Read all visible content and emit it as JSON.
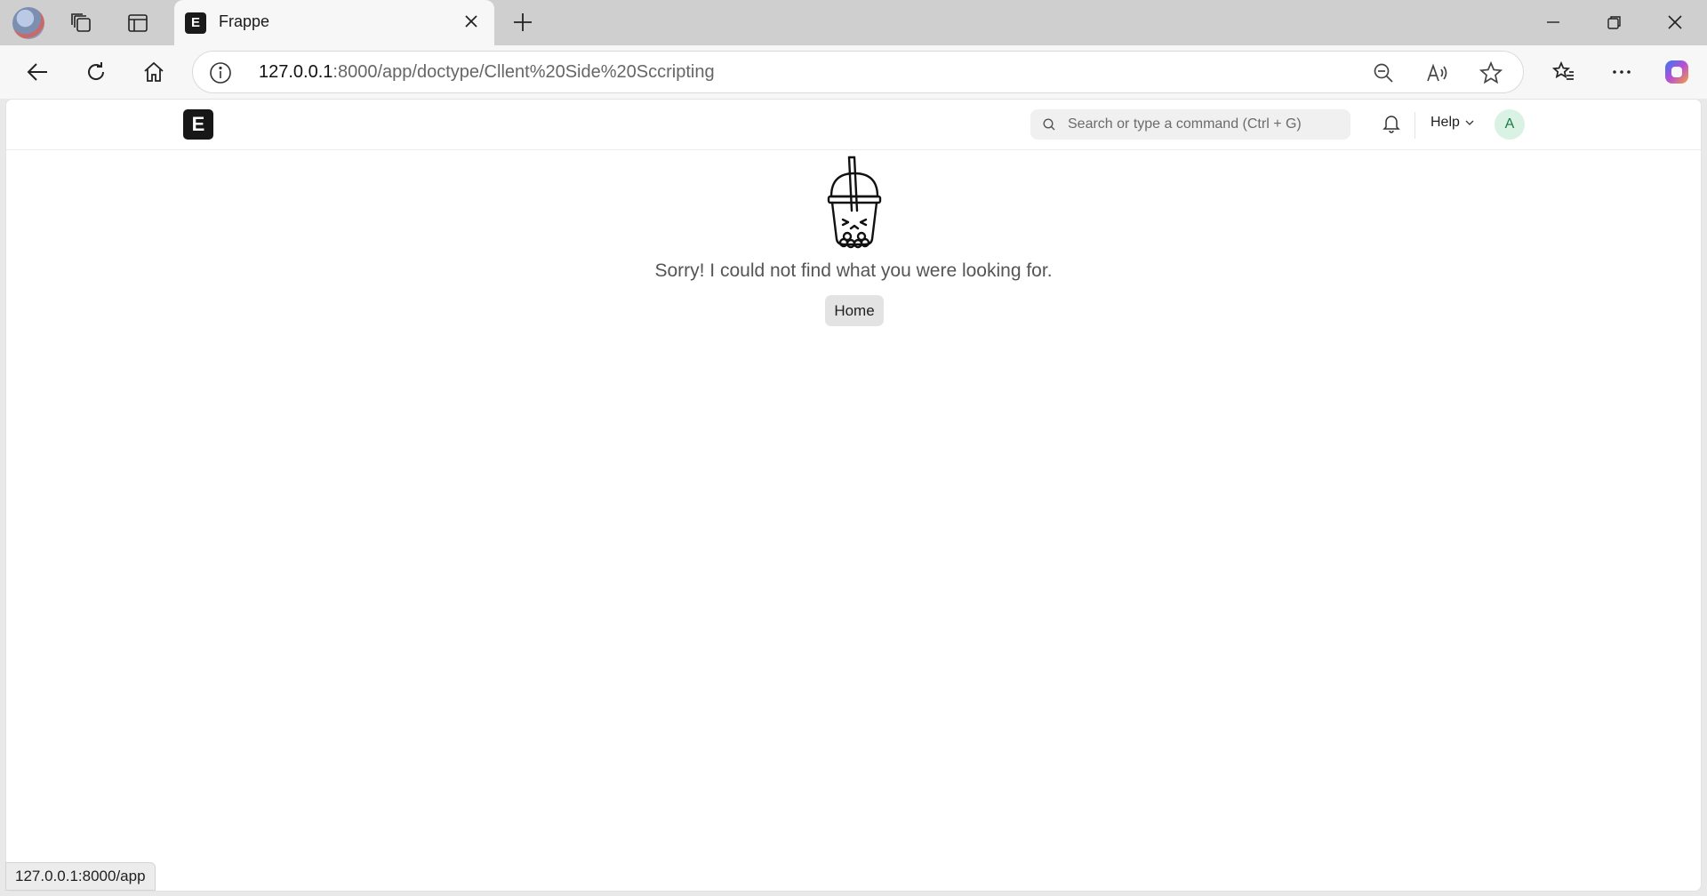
{
  "browser": {
    "tab": {
      "title": "Frappe",
      "favicon_letter": "E"
    },
    "address": {
      "host": "127.0.0.1",
      "rest": ":8000/app/doctype/Cllent%20Side%20Sccripting"
    },
    "status_url": "127.0.0.1:8000/app"
  },
  "app": {
    "logo_letter": "E",
    "search_placeholder": "Search or type a command (Ctrl + G)",
    "help_label": "Help",
    "avatar_initial": "A"
  },
  "page": {
    "message": "Sorry! I could not find what you were looking for.",
    "home_button": "Home"
  }
}
